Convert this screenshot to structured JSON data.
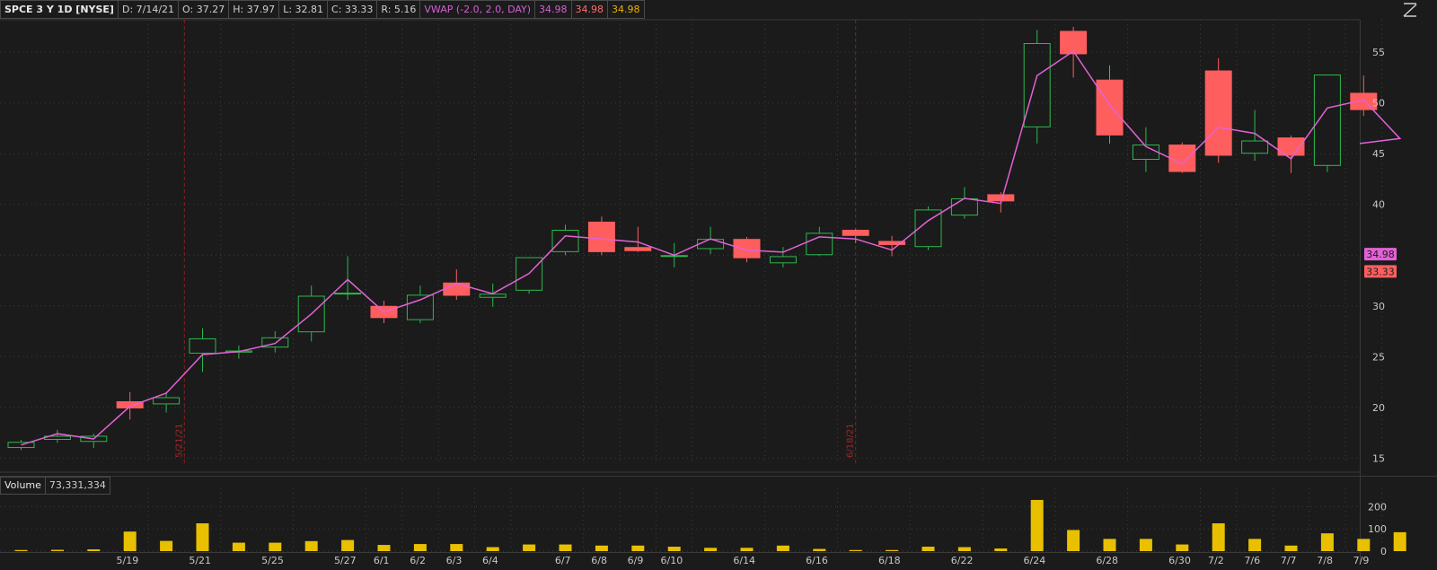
{
  "header": {
    "symbol": "SPCE 3 Y 1D [NYSE]",
    "date": "D: 7/14/21",
    "open": "O: 37.27",
    "high": "H: 37.97",
    "low": "L: 32.81",
    "close": "C: 33.33",
    "range": "R: 5.16",
    "study": "VWAP (-2.0, 2.0, DAY)",
    "study_v1": "34.98",
    "study_v2": "34.98",
    "study_v3": "34.98"
  },
  "volume_header": {
    "label": "Volume",
    "value": "73,331,334"
  },
  "price_badges": {
    "vwap": "34.98",
    "close": "33.33"
  },
  "colors": {
    "up": "#2db84d",
    "down": "#ff5e5e",
    "vwap": "#e262d6",
    "volume": "#e8c000",
    "study_text": "#d55fd3",
    "study_v2_text": "#ff6c6c",
    "study_v3_text": "#e8b000"
  },
  "chart_data": {
    "type": "candlestick",
    "price_ticks": [
      15,
      20,
      25,
      30,
      35,
      40,
      45,
      50,
      55
    ],
    "volume_ticks": [
      "0",
      "100",
      "200"
    ],
    "x_ticks": [
      "5/19",
      "5/21",
      "5/25",
      "5/27",
      "6/1",
      "6/2",
      "6/3",
      "6/4",
      "6/7",
      "6/8",
      "6/9",
      "6/10",
      "6/14",
      "6/16",
      "6/18",
      "6/22",
      "6/24",
      "6/28",
      "6/30",
      "7/2",
      "7/6",
      "7/7",
      "7/8",
      "7/9"
    ],
    "event_markers": [
      "5/21/21",
      "6/18/21"
    ],
    "candles": [
      {
        "o": 16.0,
        "h": 16.8,
        "l": 15.8,
        "c": 16.6
      },
      {
        "o": 16.8,
        "h": 17.8,
        "l": 16.5,
        "c": 17.2
      },
      {
        "o": 16.6,
        "h": 17.4,
        "l": 16.0,
        "c": 17.2
      },
      {
        "o": 20.6,
        "h": 21.5,
        "l": 18.8,
        "c": 19.9
      },
      {
        "o": 20.3,
        "h": 21.5,
        "l": 19.5,
        "c": 21.0
      },
      {
        "o": 25.3,
        "h": 27.8,
        "l": 23.5,
        "c": 26.8
      },
      {
        "o": 25.4,
        "h": 26.1,
        "l": 24.8,
        "c": 25.6
      },
      {
        "o": 25.9,
        "h": 27.5,
        "l": 25.4,
        "c": 26.9
      },
      {
        "o": 27.4,
        "h": 32.0,
        "l": 26.5,
        "c": 31.0
      },
      {
        "o": 31.3,
        "h": 34.9,
        "l": 30.6,
        "c": 31.3
      },
      {
        "o": 30.0,
        "h": 30.5,
        "l": 28.3,
        "c": 28.8
      },
      {
        "o": 28.6,
        "h": 32.0,
        "l": 28.3,
        "c": 31.1
      },
      {
        "o": 32.3,
        "h": 33.6,
        "l": 30.6,
        "c": 31.0
      },
      {
        "o": 30.8,
        "h": 32.2,
        "l": 29.9,
        "c": 31.2
      },
      {
        "o": 31.5,
        "h": 34.7,
        "l": 31.2,
        "c": 34.8
      },
      {
        "o": 35.3,
        "h": 38.0,
        "l": 35.0,
        "c": 37.5
      },
      {
        "o": 38.3,
        "h": 38.8,
        "l": 35.0,
        "c": 35.3
      },
      {
        "o": 35.8,
        "h": 37.8,
        "l": 35.3,
        "c": 35.4
      },
      {
        "o": 34.9,
        "h": 36.2,
        "l": 33.8,
        "c": 35.0
      },
      {
        "o": 35.6,
        "h": 37.8,
        "l": 35.1,
        "c": 36.6
      },
      {
        "o": 36.6,
        "h": 36.8,
        "l": 34.3,
        "c": 34.7
      },
      {
        "o": 34.2,
        "h": 35.8,
        "l": 33.8,
        "c": 34.9
      },
      {
        "o": 35.0,
        "h": 37.8,
        "l": 34.9,
        "c": 37.2
      },
      {
        "o": 37.5,
        "h": 37.6,
        "l": 36.2,
        "c": 36.9
      },
      {
        "o": 36.4,
        "h": 36.9,
        "l": 34.9,
        "c": 36.0
      },
      {
        "o": 35.8,
        "h": 39.8,
        "l": 35.5,
        "c": 39.5
      },
      {
        "o": 38.9,
        "h": 41.7,
        "l": 38.6,
        "c": 40.6
      },
      {
        "o": 41.0,
        "h": 41.2,
        "l": 39.2,
        "c": 40.3
      },
      {
        "o": 47.6,
        "h": 57.2,
        "l": 46.0,
        "c": 55.9
      },
      {
        "o": 57.1,
        "h": 57.5,
        "l": 52.5,
        "c": 54.8
      },
      {
        "o": 52.3,
        "h": 53.7,
        "l": 46.0,
        "c": 46.8
      },
      {
        "o": 44.4,
        "h": 47.6,
        "l": 43.2,
        "c": 45.9
      },
      {
        "o": 45.9,
        "h": 46.1,
        "l": 43.1,
        "c": 43.2
      },
      {
        "o": 53.2,
        "h": 54.4,
        "l": 44.1,
        "c": 44.8
      },
      {
        "o": 45.0,
        "h": 49.3,
        "l": 44.3,
        "c": 46.3
      },
      {
        "o": 46.6,
        "h": 46.8,
        "l": 43.1,
        "c": 44.8
      },
      {
        "o": 43.8,
        "h": 52.8,
        "l": 43.2,
        "c": 52.8
      },
      {
        "o": 51.0,
        "h": 52.7,
        "l": 48.7,
        "c": 49.3
      },
      {
        "o": 37.3,
        "h": 38.0,
        "l": 32.8,
        "c": 33.3
      }
    ],
    "vwap": [
      16.3,
      17.4,
      16.9,
      20.1,
      21.4,
      25.2,
      25.5,
      26.3,
      29.2,
      32.6,
      29.4,
      30.6,
      32.2,
      31.2,
      33.2,
      36.9,
      36.6,
      36.3,
      35.0,
      36.6,
      35.5,
      35.3,
      36.8,
      36.6,
      35.5,
      38.4,
      40.6,
      40.1,
      52.7,
      55.1,
      49.8,
      45.7,
      44.0,
      47.6,
      47.0,
      44.5,
      49.5,
      50.3,
      46.5
    ],
    "volume": [
      5,
      6,
      8,
      88,
      46,
      125,
      38,
      38,
      45,
      50,
      28,
      32,
      32,
      18,
      30,
      30,
      25,
      25,
      20,
      15,
      15,
      25,
      10,
      5,
      5,
      20,
      18,
      12,
      230,
      95,
      55,
      55,
      30,
      125,
      55,
      25,
      80,
      55,
      85
    ]
  }
}
